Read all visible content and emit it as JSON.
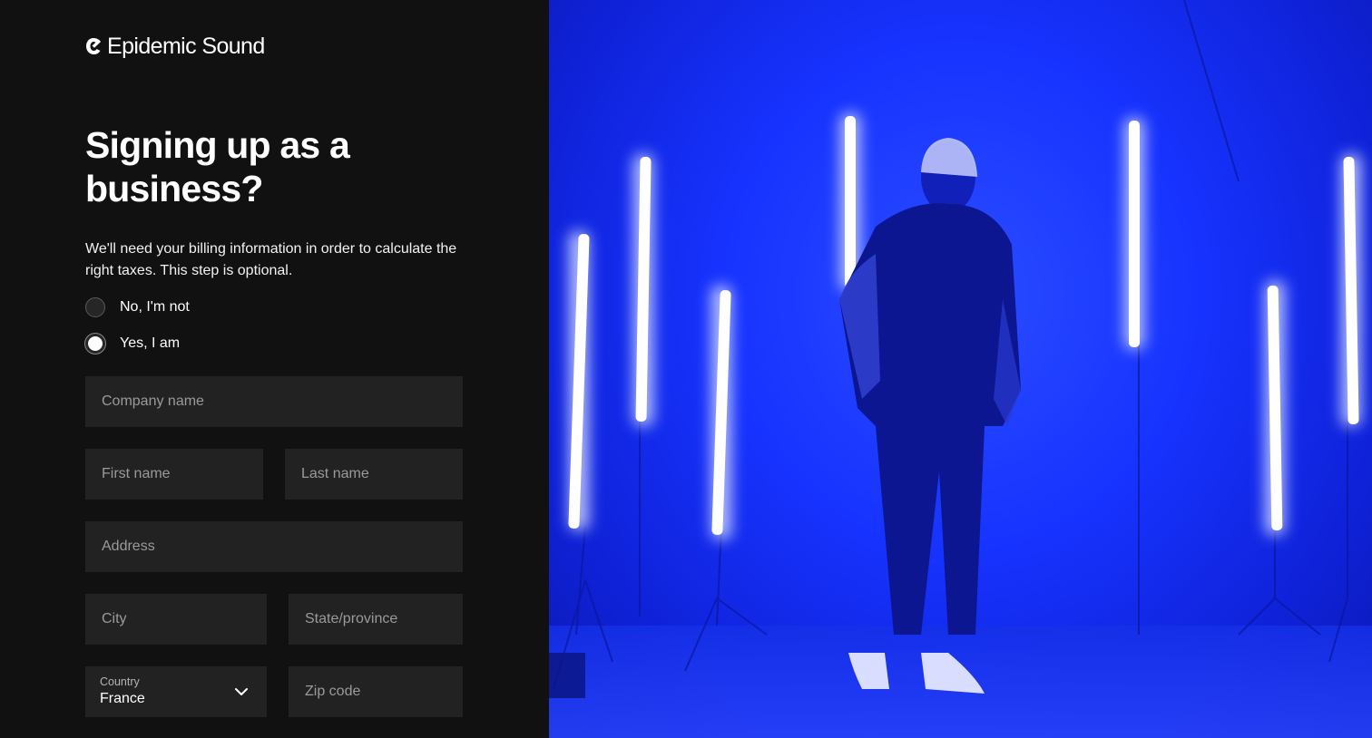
{
  "brand": {
    "name": "Epidemic Sound"
  },
  "form": {
    "title": "Signing up as a business?",
    "description": "We'll need your billing information in order to calculate the right taxes. This step is optional.",
    "options": [
      {
        "label": "No, I'm not",
        "checked": false
      },
      {
        "label": "Yes, I am",
        "checked": true
      }
    ],
    "fields": {
      "company_placeholder": "Company name",
      "first_name_placeholder": "First name",
      "last_name_placeholder": "Last name",
      "address_placeholder": "Address",
      "city_placeholder": "City",
      "state_placeholder": "State/province",
      "country_label": "Country",
      "country_value": "France",
      "zip_placeholder": "Zip code"
    }
  },
  "hero": {
    "image": "person-under-blue-neon-lights",
    "accent_color": "#1a36ff"
  }
}
